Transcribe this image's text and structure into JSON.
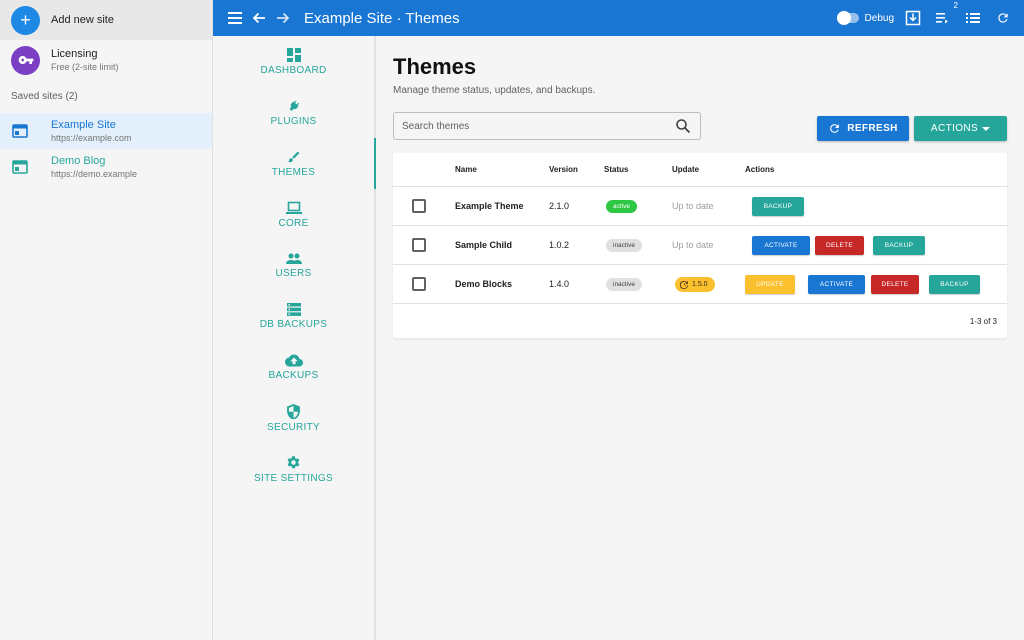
{
  "sidebar": {
    "add_label": "Add new site",
    "add_symbol": "+",
    "licensing": {
      "title": "Licensing",
      "subtitle": "Free (2-site limit)"
    },
    "saved_header": "Saved sites (2)",
    "sites": [
      {
        "name": "Example Site",
        "url": "https://example.com"
      },
      {
        "name": "Demo Blog",
        "url": "https://demo.example"
      }
    ]
  },
  "appbar": {
    "title": "Example Site · Themes",
    "debug_label": "Debug",
    "queue_count": "2"
  },
  "nav": {
    "items": [
      {
        "label": "DASHBOARD",
        "icon": "dashboard-icon"
      },
      {
        "label": "PLUGINS",
        "icon": "plug-icon"
      },
      {
        "label": "THEMES",
        "icon": "brush-icon"
      },
      {
        "label": "CORE",
        "icon": "laptop-icon"
      },
      {
        "label": "USERS",
        "icon": "users-icon"
      },
      {
        "label": "DB BACKUPS",
        "icon": "database-icon"
      },
      {
        "label": "BACKUPS",
        "icon": "cloud-upload-icon"
      },
      {
        "label": "SECURITY",
        "icon": "shield-icon"
      },
      {
        "label": "SITE SETTINGS",
        "icon": "gear-icon"
      }
    ]
  },
  "main": {
    "title": "Themes",
    "subtitle": "Manage theme status, updates, and backups.",
    "search_placeholder": "Search themes",
    "refresh_label": "REFRESH",
    "actions_label": "ACTIONS",
    "columns": {
      "name": "Name",
      "version": "Version",
      "status": "Status",
      "update": "Update",
      "actions": "Actions"
    },
    "rows": [
      {
        "name": "Example Theme",
        "version": "2.1.0",
        "status": "active",
        "update": "Up to date",
        "backup": "BACKUP"
      },
      {
        "name": "Sample Child",
        "version": "1.0.2",
        "status": "inactive",
        "update": "Up to date",
        "activate": "ACTIVATE",
        "delete": "DELETE",
        "backup": "BACKUP"
      },
      {
        "name": "Demo Blocks",
        "version": "1.4.0",
        "status": "inactive",
        "update_version": "1.5.0",
        "update_btn": "UPDATE",
        "activate": "ACTIVATE",
        "delete": "DELETE",
        "backup": "BACKUP"
      }
    ],
    "pagination": "1-3 of 3"
  },
  "colors": {
    "primary": "#1976d2",
    "teal": "#26a69a",
    "danger": "#c62828",
    "warning": "#fbc02d",
    "success": "#2ec743",
    "licensing": "#7b3fc4"
  }
}
